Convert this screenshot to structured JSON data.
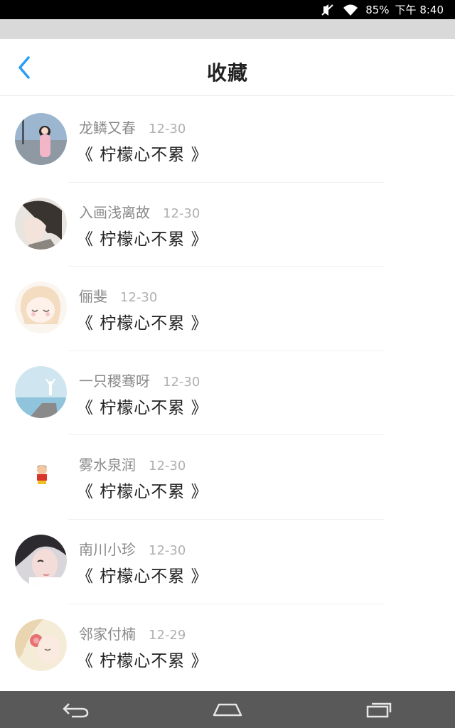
{
  "status_bar": {
    "battery": "85%",
    "time": "下午 8:40"
  },
  "header": {
    "title": "收藏"
  },
  "colors": {
    "accent": "#2a9df4",
    "status_bar": "#000000",
    "nav_bar": "#595959"
  },
  "items": [
    {
      "username": "龙鳞又春",
      "date": "12-30",
      "title": "《 柠檬心不累 》",
      "avatar": "girl-photo"
    },
    {
      "username": "入画浅离故",
      "date": "12-30",
      "title": "《 柠檬心不累 》",
      "avatar": "anime-boy"
    },
    {
      "username": "俪斐",
      "date": "12-30",
      "title": "《 柠檬心不累 》",
      "avatar": "anime-girl-sleeping"
    },
    {
      "username": "一只稷骞呀",
      "date": "12-30",
      "title": "《 柠檬心不累 》",
      "avatar": "seaside-yoga"
    },
    {
      "username": "雾水泉润",
      "date": "12-30",
      "title": "《 柠檬心不累 》",
      "avatar": "crayon-shin-chan"
    },
    {
      "username": "南川小珍",
      "date": "12-30",
      "title": "《 柠檬心不累 》",
      "avatar": "girl-portrait"
    },
    {
      "username": "邻家付楠",
      "date": "12-29",
      "title": "《 柠檬心不累 》",
      "avatar": "girl-flower-illustration"
    }
  ],
  "nav": {
    "back_icon": "back-arrow-icon",
    "home_icon": "home-icon",
    "recents_icon": "recent-apps-icon"
  }
}
